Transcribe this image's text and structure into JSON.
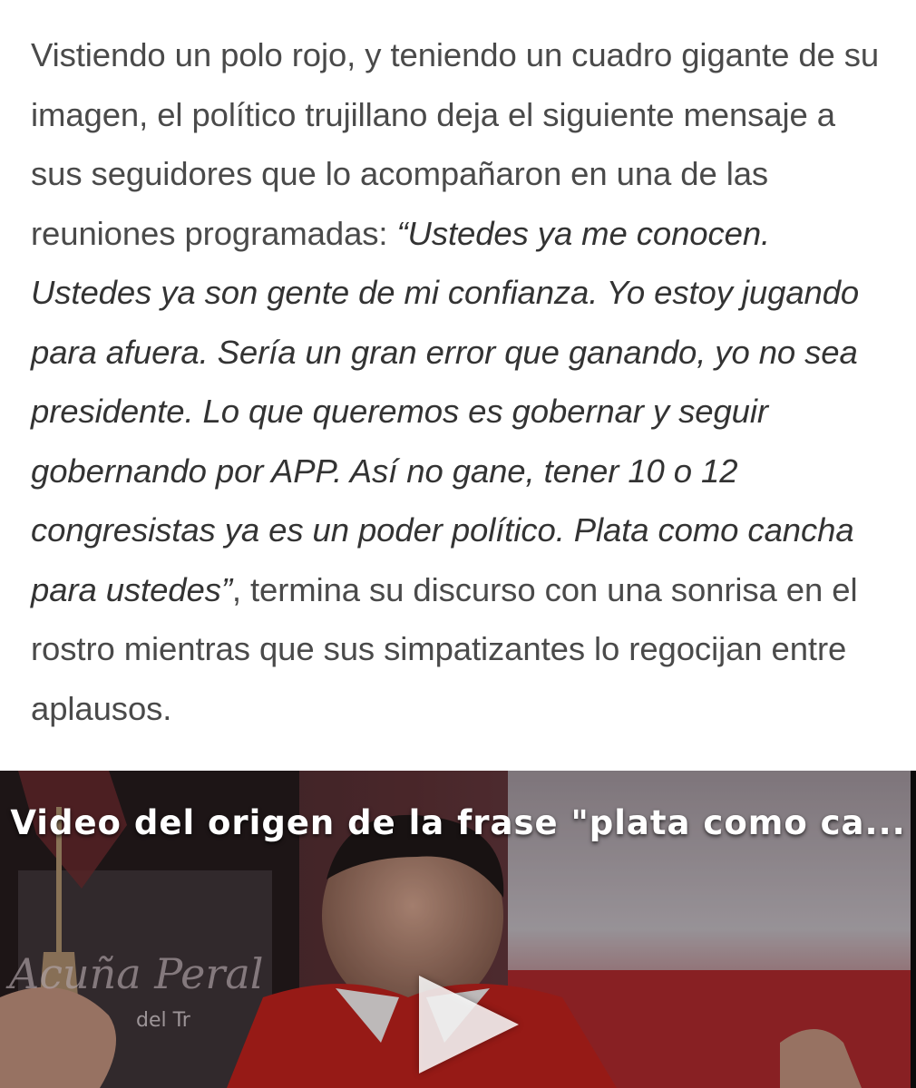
{
  "article": {
    "intro": "Vistiendo un polo rojo, y teniendo un cuadro gigante de su imagen, el político trujillano deja el siguiente mensaje a sus seguidores que lo acompañaron en una de las reuniones programadas: ",
    "quote": "“Ustedes ya me conocen. Ustedes ya son gente de mi confianza. Yo estoy jugando para afuera. Sería un gran error que ganando, yo no sea presidente. Lo que queremos es gobernar y seguir gobernando por APP. Así no gane, tener 10 o 12 congresistas ya es un poder político. Plata como cancha para ustedes”",
    "outro": ", termina su discurso con una sonrisa en el rostro mientras que sus simpatizantes lo regocijan entre aplausos."
  },
  "video": {
    "title": "Video del origen de la frase \"plata como ca...",
    "play_icon": "play-icon",
    "thumbnail_text": {
      "name": "Acuña Peral",
      "caption": "del Tr"
    },
    "colors": {
      "shirt": "#b8201c",
      "background_red": "#a11f22",
      "title_text": "#ffffff"
    }
  }
}
